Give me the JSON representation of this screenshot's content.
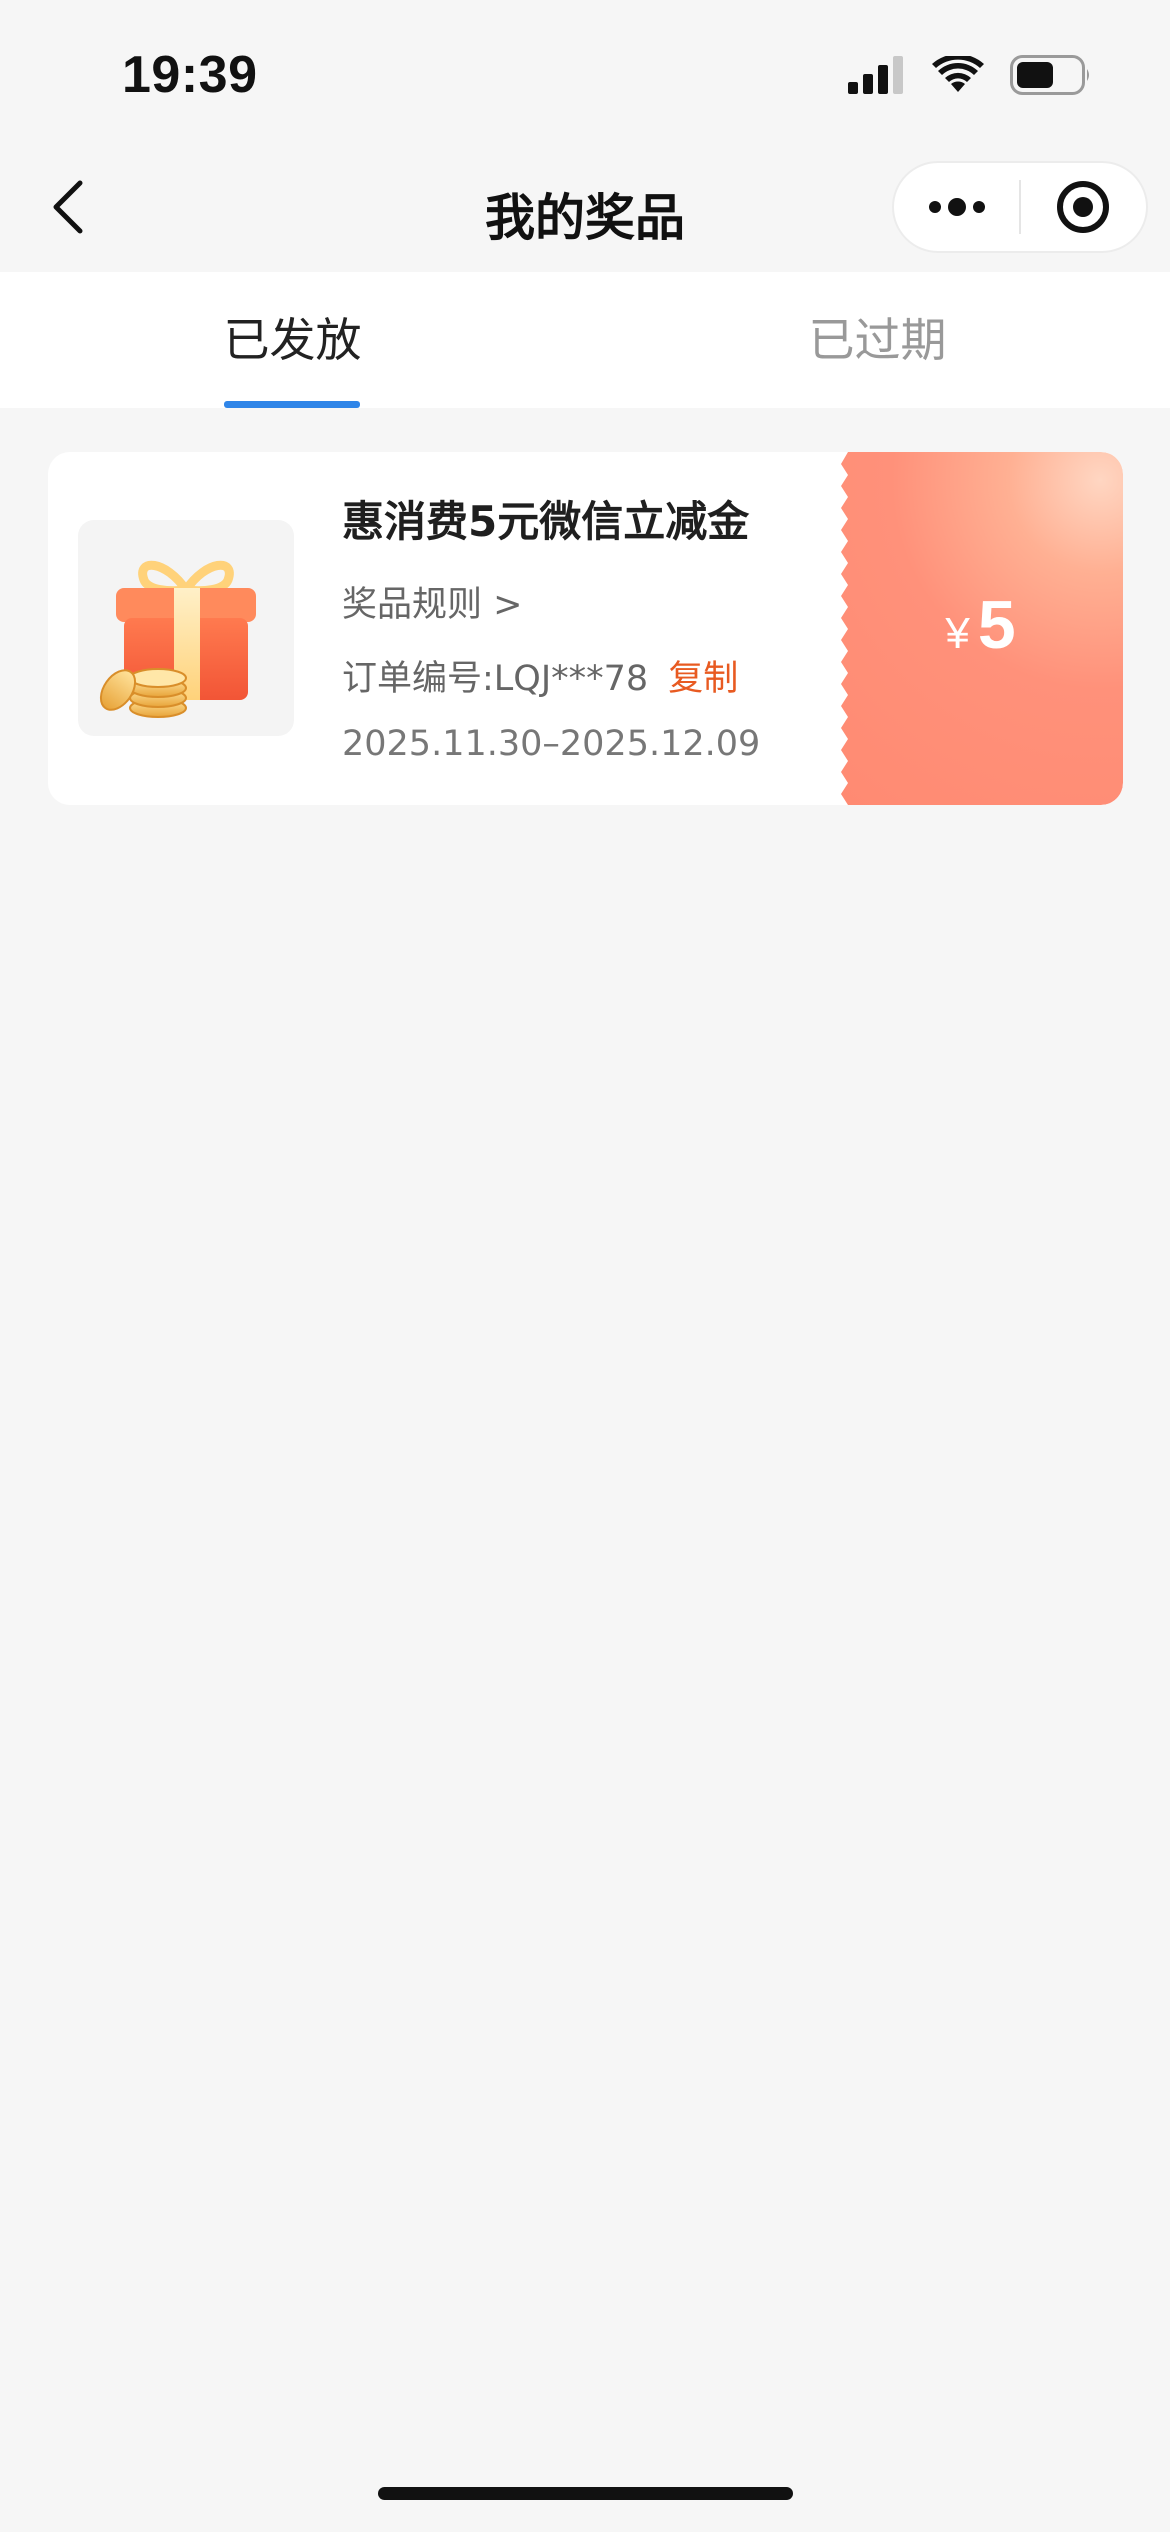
{
  "status_bar": {
    "time": "19:39"
  },
  "nav": {
    "title": "我的奖品",
    "capsule": {
      "more_icon": "more-dots-icon",
      "close_icon": "target-circle-icon"
    }
  },
  "tabs": [
    {
      "label": "已发放",
      "active": true
    },
    {
      "label": "已过期",
      "active": false
    }
  ],
  "prize_card": {
    "title": "惠消费5元微信立减金",
    "rule_link": "奖品规则 >",
    "order_label": "订单编号:LQJ***78",
    "copy_label": "复制",
    "date_range": "2025.11.30–2025.12.09",
    "currency": "¥",
    "amount": "5",
    "icon": "gift-box-coins-icon"
  },
  "colors": {
    "accent_blue": "#2f85e8",
    "copy_orange": "#e85a21",
    "coupon_gradient_start": "#ffd6c2",
    "coupon_gradient_end": "#ff8a72",
    "background": "#f6f6f6"
  }
}
